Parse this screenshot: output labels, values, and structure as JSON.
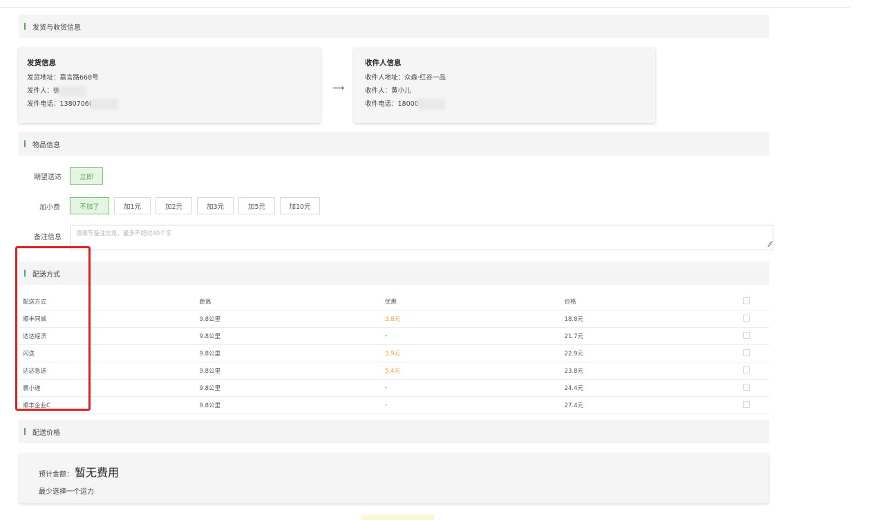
{
  "sections": {
    "shipping": "发货与收货信息",
    "items": "物品信息",
    "delivery": "配送方式",
    "pricing": "配送价格"
  },
  "sender": {
    "title": "发货信息",
    "address_label": "发货地址：",
    "address": "嘉言路668号",
    "name_label": "发件人：",
    "name": "徐",
    "phone_label": "发件电话：",
    "phone": "1380706("
  },
  "arrow": "⟶",
  "receiver": {
    "title": "收件人信息",
    "address_label": "收件人地址：",
    "address": "众森·红谷一品",
    "name_label": "收件人：",
    "name": "黄小儿",
    "phone_label": "收件电话：",
    "phone": "18000"
  },
  "expected": {
    "label": "期望送达",
    "options": [
      "立即"
    ],
    "selected": "立即"
  },
  "tip": {
    "label": "加小费",
    "options": [
      "不加了",
      "加1元",
      "加2元",
      "加3元",
      "加5元",
      "加10元"
    ],
    "selected": "不加了"
  },
  "remark": {
    "label": "备注信息",
    "placeholder": "请填写备注信息，最多不超过40个字"
  },
  "delivery_table": {
    "headers": [
      "配送方式",
      "距离",
      "优惠",
      "价格"
    ],
    "rows": [
      {
        "method": "顺丰同城",
        "distance": "9.8公里",
        "discount": "3.8元",
        "price": "18.8元"
      },
      {
        "method": "达达经济",
        "distance": "9.8公里",
        "discount": "-",
        "price": "21.7元"
      },
      {
        "method": "闪送",
        "distance": "9.8公里",
        "discount": "3.9元",
        "price": "22.9元"
      },
      {
        "method": "达达急送",
        "distance": "9.8公里",
        "discount": "5.4元",
        "price": "23.8元"
      },
      {
        "method": "裹小递",
        "distance": "9.8公里",
        "discount": "-",
        "price": "24.4元"
      },
      {
        "method": "顺丰企业C",
        "distance": "9.8公里",
        "discount": "-",
        "price": "27.4元"
      }
    ]
  },
  "price": {
    "label": "预计金额：",
    "value": "暂无费用",
    "hint": "最少选择一个运力"
  },
  "colors": {
    "accent": "#4caf50",
    "discount": "#f0a040",
    "highlight": "#e02020"
  }
}
